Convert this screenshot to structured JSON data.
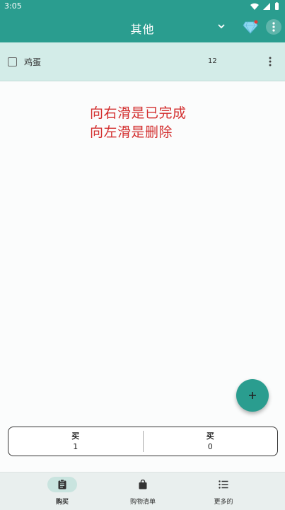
{
  "status": {
    "time": "3:05"
  },
  "app_bar": {
    "title": "其他"
  },
  "list": {
    "items": [
      {
        "name": "鸡蛋",
        "quantity": "12"
      }
    ]
  },
  "hint": {
    "line1": "向右滑是已完成",
    "line2": "向左滑是删除"
  },
  "fab": {
    "label": "+"
  },
  "summary": [
    {
      "label": "买",
      "value": "1"
    },
    {
      "label": "买",
      "value": "0"
    }
  ],
  "bottom_nav": [
    {
      "label": "购买",
      "icon": "clipboard-icon",
      "active": true
    },
    {
      "label": "购物清单",
      "icon": "shopping-bag-icon",
      "active": false
    },
    {
      "label": "更多的",
      "icon": "list-icon",
      "active": false
    }
  ],
  "colors": {
    "primary": "#2a9d8f",
    "item_bg": "#d3ece8",
    "hint": "#d32f2f"
  }
}
